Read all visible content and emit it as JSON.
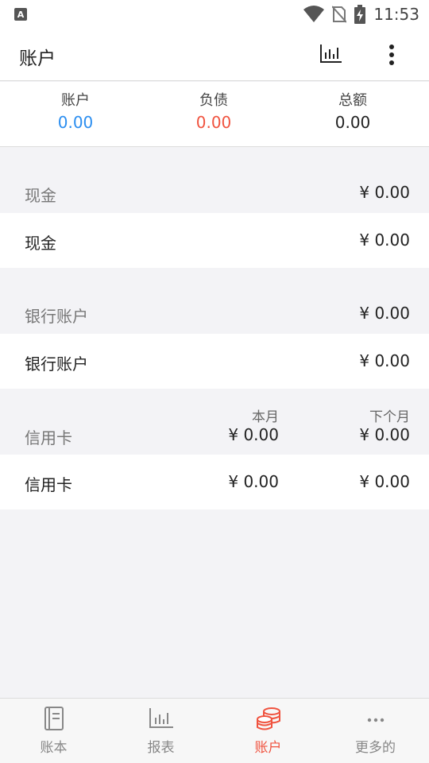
{
  "status_bar": {
    "time": "11:53",
    "app_icon": "A"
  },
  "appbar": {
    "title": "账户",
    "chart_icon": "bar-chart-icon",
    "more_icon": "more-vertical-icon"
  },
  "summary": {
    "accounts": {
      "label": "账户",
      "value": "0.00",
      "color": "#2b8ef0"
    },
    "liabilities": {
      "label": "负债",
      "value": "0.00",
      "color": "#f0533f"
    },
    "total": {
      "label": "总额",
      "value": "0.00",
      "color": "#222222"
    }
  },
  "sections": {
    "cash": {
      "header": "现金",
      "header_amount": "¥ 0.00",
      "row_label": "现金",
      "row_amount": "¥ 0.00"
    },
    "bank": {
      "header": "银行账户",
      "header_amount": "¥ 0.00",
      "row_label": "银行账户",
      "row_amount": "¥ 0.00"
    },
    "credit": {
      "header": "信用卡",
      "col_this_month": "本月",
      "col_next_month": "下个月",
      "header_this_month": "¥ 0.00",
      "header_next_month": "¥ 0.00",
      "row_label": "信用卡",
      "row_this_month": "¥ 0.00",
      "row_next_month": "¥ 0.00"
    }
  },
  "bottom_nav": [
    {
      "label": "账本",
      "icon": "book-icon"
    },
    {
      "label": "报表",
      "icon": "bar-chart-icon"
    },
    {
      "label": "账户",
      "icon": "coins-icon",
      "active": true
    },
    {
      "label": "更多的",
      "icon": "more-horizontal-icon"
    }
  ],
  "colors": {
    "accent": "#f0533f",
    "blue": "#2b8ef0"
  }
}
